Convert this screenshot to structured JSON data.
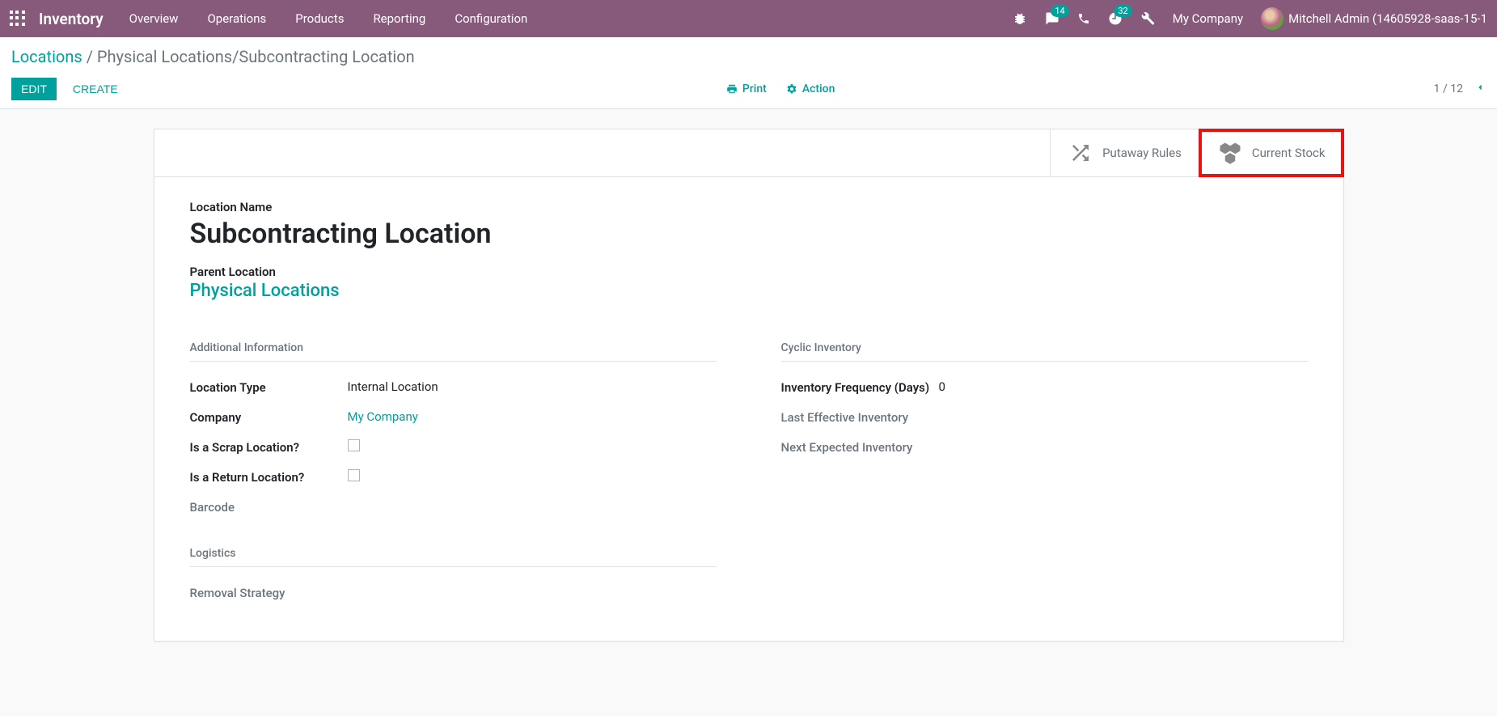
{
  "navbar": {
    "brand": "Inventory",
    "menu": [
      "Overview",
      "Operations",
      "Products",
      "Reporting",
      "Configuration"
    ],
    "messages_badge": "14",
    "activities_badge": "32",
    "company": "My Company",
    "user": "Mitchell Admin (14605928-saas-15-1"
  },
  "control_panel": {
    "breadcrumb_root": "Locations",
    "breadcrumb_current": "Physical Locations/Subcontracting Location",
    "edit": "EDIT",
    "create": "CREATE",
    "print": "Print",
    "action": "Action",
    "pager": "1 / 12"
  },
  "stat_buttons": {
    "putaway": "Putaway Rules",
    "current_stock": "Current Stock"
  },
  "form": {
    "location_name_label": "Location Name",
    "location_name": "Subcontracting Location",
    "parent_location_label": "Parent Location",
    "parent_location": "Physical Locations",
    "additional_info_title": "Additional Information",
    "location_type_label": "Location Type",
    "location_type": "Internal Location",
    "company_label": "Company",
    "company": "My Company",
    "is_scrap_label": "Is a Scrap Location?",
    "is_return_label": "Is a Return Location?",
    "barcode_label": "Barcode",
    "logistics_title": "Logistics",
    "removal_strategy_label": "Removal Strategy",
    "cyclic_title": "Cyclic Inventory",
    "inv_freq_label": "Inventory Frequency (Days)",
    "inv_freq": "0",
    "last_eff_label": "Last Effective Inventory",
    "next_exp_label": "Next Expected Inventory"
  }
}
